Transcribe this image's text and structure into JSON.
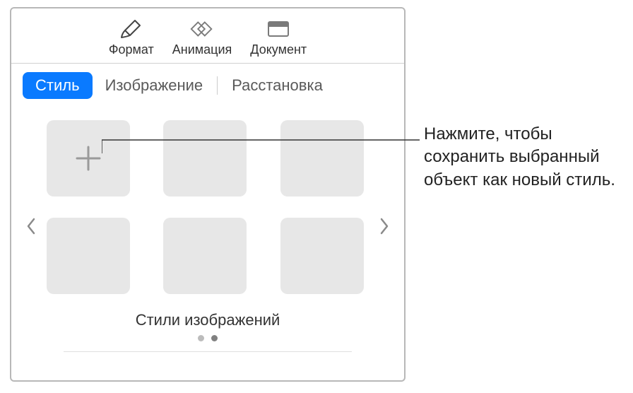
{
  "toolbar": {
    "format_label": "Формат",
    "animate_label": "Анимация",
    "document_label": "Документ"
  },
  "tabs": {
    "style": "Стиль",
    "image": "Изображение",
    "arrange": "Расстановка"
  },
  "styles": {
    "heading": "Стили изображений"
  },
  "callout": {
    "text": "Нажмите, чтобы сохранить выбранный объект как новый стиль."
  }
}
